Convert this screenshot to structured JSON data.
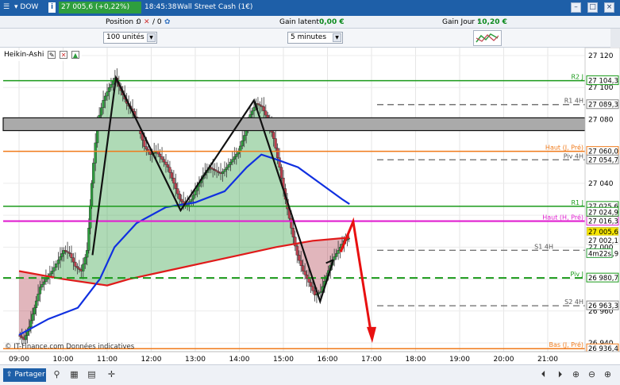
{
  "titlebar": {
    "symbol": "DOW",
    "info_mark": "i",
    "price": "27 005,6 (+0,22%)",
    "time": "18:45:38",
    "instrument": "Wall Street Cash (1€)",
    "minimize": "–",
    "restore": "□",
    "close": "×"
  },
  "infobar": {
    "position_label": "Position :",
    "position_value": "0",
    "position_sep": "/ 0",
    "latent_label": "Gain latent :",
    "latent_value": "0,00 €",
    "day_label": "Gain Jour :",
    "day_value": "10,20 €"
  },
  "toolbar": {
    "units": "100 unités",
    "timeframe": "5 minutes"
  },
  "indicator": {
    "name": "Heikin-Ashi",
    "copyright": "© IT-Finance.com Données indicatives"
  },
  "chart_data": {
    "type": "candlestick",
    "y_ticks": [
      "27 120",
      "27 100",
      "27 080",
      "27 060",
      "27 040",
      "27 020",
      "27 000",
      "26 980",
      "26 960",
      "26 940"
    ],
    "x_ticks": [
      "09:00",
      "10:00",
      "11:00",
      "12:00",
      "13:00",
      "14:00",
      "15:00",
      "16:00",
      "17:00",
      "18:00",
      "19:00",
      "20:00",
      "21:00"
    ],
    "levels": [
      {
        "label": "R2 J",
        "value": "27 104,3",
        "color": "#1a9a1a"
      },
      {
        "label": "R1 4H",
        "value": "27 089,3",
        "color": "#888888"
      },
      {
        "label": "Haut (J, Pré)",
        "value": "27 060,0",
        "color": "#f07a1a"
      },
      {
        "label": "Piv 4H",
        "value": "27 054,7",
        "color": "#888888"
      },
      {
        "label": "R1 J",
        "value": "27 025,6",
        "color": "#1a9a1a"
      },
      {
        "label": "",
        "value": "27 024,9",
        "color": "#1a9a1a"
      },
      {
        "label": "Haut (H, Pré)",
        "value": "27 016,3",
        "color": "#e020d0"
      },
      {
        "label": "",
        "value": "27 005,6",
        "color": "#f5e400"
      },
      {
        "label": "",
        "value": "27 002,1",
        "color": "#dddddd"
      },
      {
        "label": "S1 4H",
        "value": "",
        "color": "#888888"
      },
      {
        "label": "",
        "value": "4m22s",
        "color": "#2e9e3e"
      },
      {
        "label": "Piv J",
        "value": "26 980,7",
        "color": "#1a9a1a"
      },
      {
        "label": "S2 4H",
        "value": "26 963,3",
        "color": "#888888"
      },
      {
        "label": "Bas (J, Pré)",
        "value": "26 936,4",
        "color": "#f07a1a"
      }
    ],
    "value_suffix_s1": ",9",
    "colors": {
      "up": "#2e9e3e",
      "down": "#c0404f",
      "ma_fast": "#1030e0",
      "ma_slow": "#e01a1a"
    }
  },
  "bottombar": {
    "share": "Partager"
  }
}
